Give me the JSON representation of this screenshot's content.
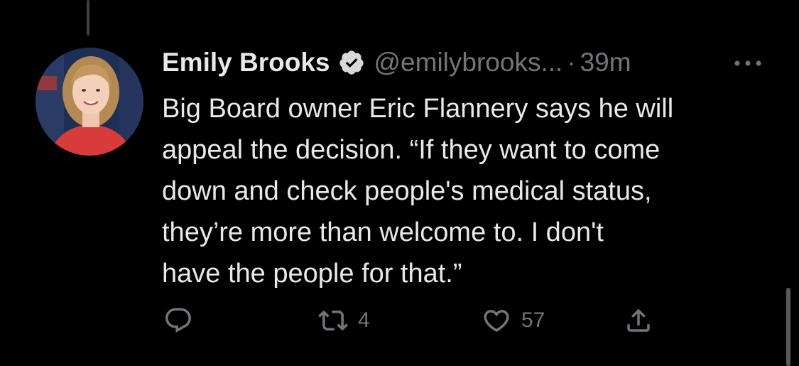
{
  "tweet": {
    "author": {
      "display_name": "Emily Brooks",
      "handle": "@emilybrooks...",
      "verified": true
    },
    "separator": "·",
    "timestamp": "39m",
    "text_lines": [
      "Big Board owner Eric Flannery says he will",
      "appeal the decision. “If they want to come",
      "down and check people's medical status,",
      "they’re more than welcome to. I don't",
      "have the people for that.”"
    ],
    "actions": {
      "reply": {
        "icon": "reply-icon",
        "count": ""
      },
      "retweet": {
        "icon": "retweet-icon",
        "count": "4"
      },
      "like": {
        "icon": "heart-icon",
        "count": "57"
      },
      "share": {
        "icon": "share-icon",
        "count": ""
      }
    }
  },
  "colors": {
    "background": "#000000",
    "text_primary": "#e7e9ea",
    "text_secondary": "#71767b",
    "verified_badge": "#d9d9d9"
  }
}
